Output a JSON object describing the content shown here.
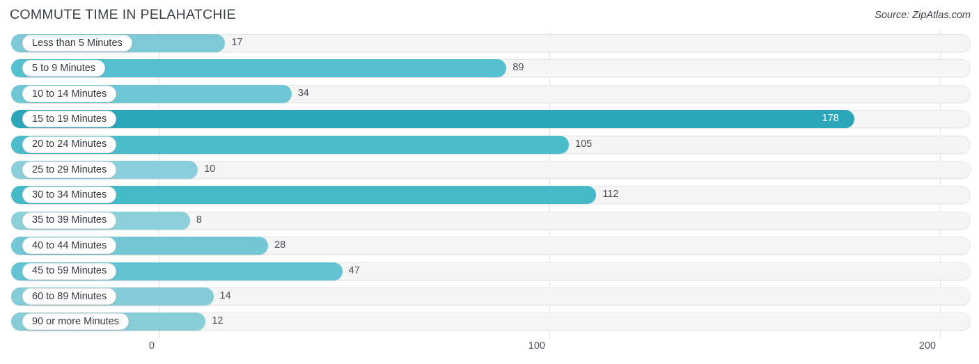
{
  "header": {
    "title": "COMMUTE TIME IN PELAHATCHIE",
    "source": "Source: ZipAtlas.com"
  },
  "chart_data": {
    "type": "bar",
    "orientation": "horizontal",
    "title": "COMMUTE TIME IN PELAHATCHIE",
    "xlabel": "",
    "ylabel": "",
    "xlim": [
      0,
      200
    ],
    "ticks": [
      0,
      100,
      200
    ],
    "tick_labels": [
      "0",
      "100",
      "200"
    ],
    "grid": true,
    "legend": false,
    "categories": [
      "Less than 5 Minutes",
      "5 to 9 Minutes",
      "10 to 14 Minutes",
      "15 to 19 Minutes",
      "20 to 24 Minutes",
      "25 to 29 Minutes",
      "30 to 34 Minutes",
      "35 to 39 Minutes",
      "40 to 44 Minutes",
      "45 to 59 Minutes",
      "60 to 89 Minutes",
      "90 or more Minutes"
    ],
    "values": [
      17,
      89,
      34,
      178,
      105,
      10,
      112,
      8,
      28,
      47,
      14,
      12
    ],
    "value_labels": [
      "17",
      "89",
      "34",
      "178",
      "105",
      "10",
      "112",
      "8",
      "28",
      "47",
      "14",
      "12"
    ],
    "bar_colors": [
      "#7ec9d6",
      "#55c0cf",
      "#6fc6d4",
      "#2ba6b8",
      "#4bbccc",
      "#8bcedb",
      "#45bac9",
      "#8dcfdb",
      "#74c7d5",
      "#63c3d2",
      "#85ccd9",
      "#87cdd8"
    ],
    "colors": {
      "track": "#f5f5f5",
      "track_border": "#e6e6e6",
      "gridline": "#e2e2e2",
      "text": "#4a4f58",
      "pill_background": "#ffffff",
      "inside_label": "#ffffff",
      "accent_max": "#2ba6b8",
      "accent_min": "#8dcfdb"
    }
  }
}
